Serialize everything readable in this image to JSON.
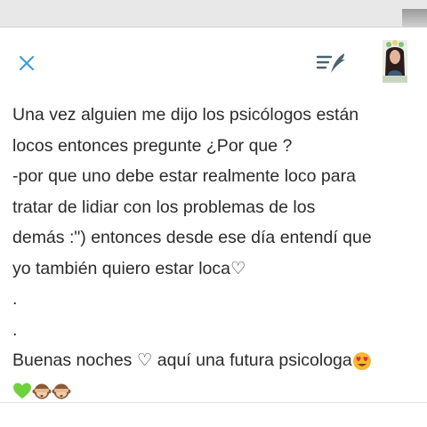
{
  "header": {
    "close_icon": "close-icon",
    "publish_icon": "publish-quill-icon",
    "avatar_icon": "user-avatar",
    "accent_color": "#3a9fd6"
  },
  "post": {
    "lines": [
      "Una vez alguien me dijo los psicólogos están",
      "locos  entonces pregunte ¿Por que ?",
      "-por que uno debe estar realmente loco para",
      "tratar de lidiar con los problemas de los",
      "demás :\") entonces desde ese día entendí que",
      "yo también quiero estar loca♡",
      ".",
      ".",
      "Buenas noches ♡ aquí una futura psicologa"
    ],
    "emoji_line_icons": [
      "green-heart-emoji",
      "see-no-evil-monkey-emoji",
      "see-no-evil-monkey-emoji"
    ],
    "trailing_emoji": "heart-eyes-emoji"
  }
}
